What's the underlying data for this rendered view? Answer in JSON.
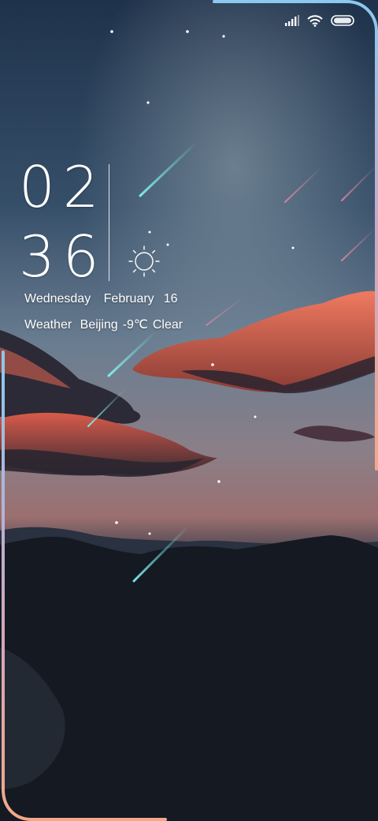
{
  "clock": {
    "hour": "02",
    "minute": "36"
  },
  "date": {
    "weekday": "Wednesday",
    "month": "February",
    "day": "16"
  },
  "weather": {
    "label": "Weather",
    "city": "Beijing",
    "temperature": "-9℃",
    "condition": "Clear",
    "icon": "sun-icon"
  },
  "status_bar": {
    "icons": [
      "signal-icon",
      "wifi-icon",
      "battery-icon"
    ]
  },
  "colors": {
    "sky_top": "#243a55",
    "sky_mid": "#5b7189",
    "horizon": "#c77d73",
    "cloud": "#e5654f",
    "mountain": "#121821",
    "edge_glow_top": "#7ec0ea",
    "edge_glow_bottom": "#f4a889"
  }
}
